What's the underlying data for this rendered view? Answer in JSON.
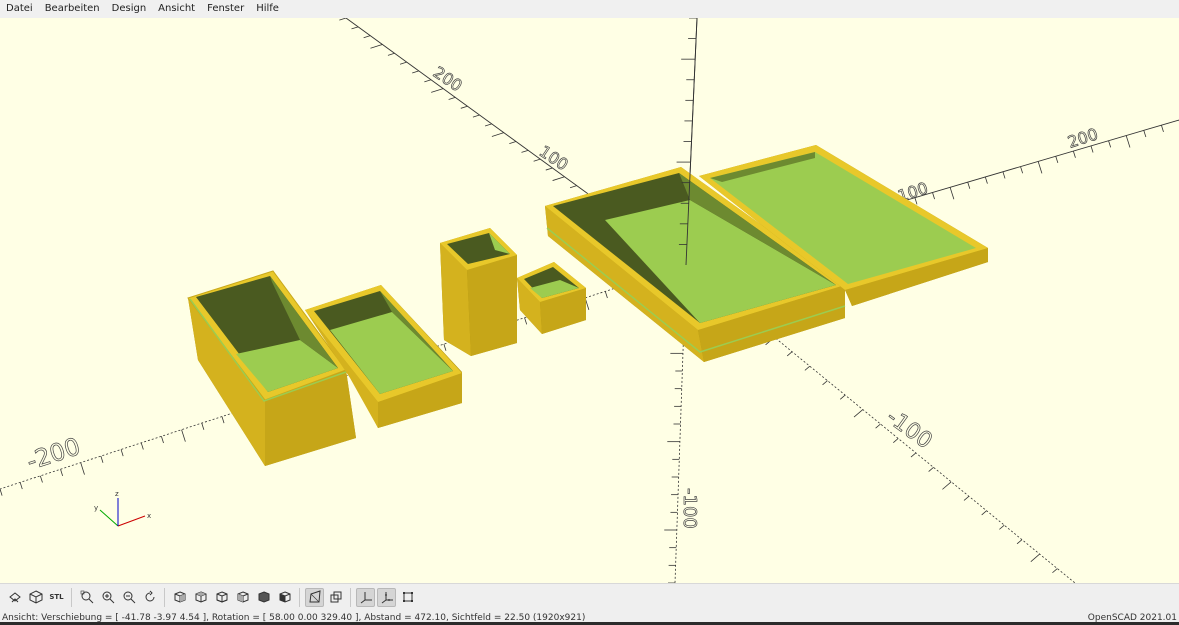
{
  "menu": {
    "items": [
      "Datei",
      "Bearbeiten",
      "Design",
      "Ansicht",
      "Fenster",
      "Hilfe"
    ]
  },
  "viewport": {
    "background": "#ffffe5",
    "model_color": "#e8c82a",
    "inner_color": "#9ccc50",
    "axis_labels": {
      "y_pos_200": "200",
      "y_pos_100": "100",
      "x_pos_200": "200",
      "x_pos_100": "100",
      "x_neg_200": "-200",
      "y_neg_100": "-100",
      "z_neg_100": "-100"
    },
    "axis_gizmo": {
      "x": "x",
      "y": "y",
      "z": "z"
    }
  },
  "toolbar": {
    "buttons": [
      {
        "name": "preview",
        "icon": "preview-icon"
      },
      {
        "name": "render",
        "icon": "render-cube-icon"
      },
      {
        "name": "export-stl",
        "label": "STL",
        "icon": "stl-icon"
      },
      {
        "name": "view-all",
        "icon": "view-all-icon"
      },
      {
        "name": "zoom-in",
        "icon": "zoom-in-icon"
      },
      {
        "name": "zoom-out",
        "icon": "zoom-out-icon"
      },
      {
        "name": "reset-view",
        "icon": "reset-view-icon"
      },
      {
        "name": "view-right",
        "icon": "view-right-icon"
      },
      {
        "name": "view-top",
        "icon": "view-top-icon"
      },
      {
        "name": "view-bottom",
        "icon": "view-bottom-icon"
      },
      {
        "name": "view-left",
        "icon": "view-left-icon"
      },
      {
        "name": "view-front",
        "icon": "view-front-icon"
      },
      {
        "name": "view-back",
        "icon": "view-back-icon"
      },
      {
        "name": "perspective",
        "icon": "perspective-icon",
        "active": true
      },
      {
        "name": "orthogonal",
        "icon": "orthogonal-icon"
      },
      {
        "name": "show-axes",
        "icon": "show-axes-icon",
        "active": true
      },
      {
        "name": "show-scale",
        "icon": "show-scale-icon",
        "active": true
      },
      {
        "name": "show-edges",
        "icon": "show-edges-icon"
      }
    ]
  },
  "status": {
    "left": "Ansicht: Verschiebung = [ -41.78 -3.97 4.54 ], Rotation = [ 58.00 0.00 329.40 ], Abstand = 472.10, Sichtfeld = 22.50 (1920x921)",
    "right": "OpenSCAD 2021.01"
  }
}
